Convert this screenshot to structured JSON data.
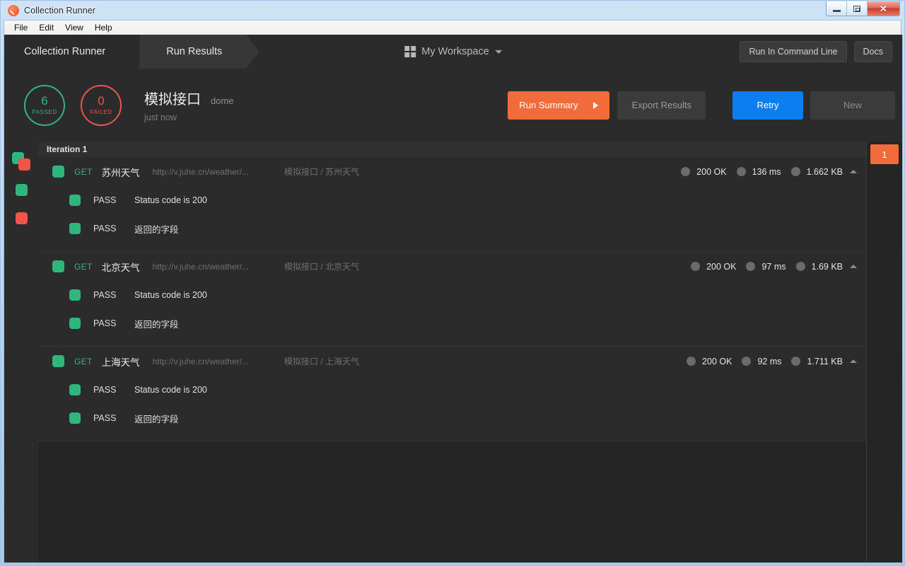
{
  "window": {
    "title": "Collection Runner",
    "icon": "postman-icon",
    "buttons": {
      "minimize": "minimize",
      "maximize": "maximize",
      "close": "✕"
    }
  },
  "menubar": {
    "items": [
      "File",
      "Edit",
      "View",
      "Help"
    ]
  },
  "topnav": {
    "tabs": [
      {
        "label": "Collection Runner",
        "active": false
      },
      {
        "label": "Run Results",
        "active": true
      }
    ],
    "workspace": {
      "label": "My Workspace",
      "icon": "grid-icon",
      "caret": "chevron-down-icon"
    },
    "buttons": [
      {
        "label": "Run In Command Line"
      },
      {
        "label": "Docs"
      }
    ]
  },
  "summary": {
    "passed": {
      "count": "6",
      "label": "PASSED",
      "color": "#2eb67d"
    },
    "failed": {
      "count": "0",
      "label": "FAILED",
      "color": "#f0544a"
    },
    "run_title": "模拟接口",
    "collection": "dome",
    "timestamp": "just now",
    "actions": {
      "run_summary": "Run Summary",
      "export_results": "Export Results",
      "retry": "Retry",
      "new": "New"
    },
    "accent_orange": "#f26b3a",
    "accent_blue": "#0d7eef"
  },
  "legend": [
    {
      "name": "all-results",
      "type": "both"
    },
    {
      "name": "passed-results",
      "type": "green"
    },
    {
      "name": "failed-results",
      "type": "red"
    }
  ],
  "results": {
    "iteration_header": "Iteration 1",
    "iteration_chip": "1",
    "requests": [
      {
        "method": "GET",
        "name": "苏州天气",
        "url": "http://v.juhe.cn/weather/...",
        "path": "模拟接口 / 苏州天气",
        "status": "200 OK",
        "time": "136 ms",
        "size": "1.662 KB",
        "tests": [
          {
            "status": "PASS",
            "name": "Status code is 200"
          },
          {
            "status": "PASS",
            "name": "返回的字段"
          }
        ]
      },
      {
        "method": "GET",
        "name": "北京天气",
        "url": "http://v.juhe.cn/weather/...",
        "path": "模拟接口 / 北京天气",
        "status": "200 OK",
        "time": "97 ms",
        "size": "1.69 KB",
        "tests": [
          {
            "status": "PASS",
            "name": "Status code is 200"
          },
          {
            "status": "PASS",
            "name": "返回的字段"
          }
        ]
      },
      {
        "method": "GET",
        "name": "上海天气",
        "url": "http://v.juhe.cn/weather/...",
        "path": "模拟接口 / 上海天气",
        "status": "200 OK",
        "time": "92 ms",
        "size": "1.711 KB",
        "tests": [
          {
            "status": "PASS",
            "name": "Status code is 200"
          },
          {
            "status": "PASS",
            "name": "返回的字段"
          }
        ]
      }
    ]
  }
}
